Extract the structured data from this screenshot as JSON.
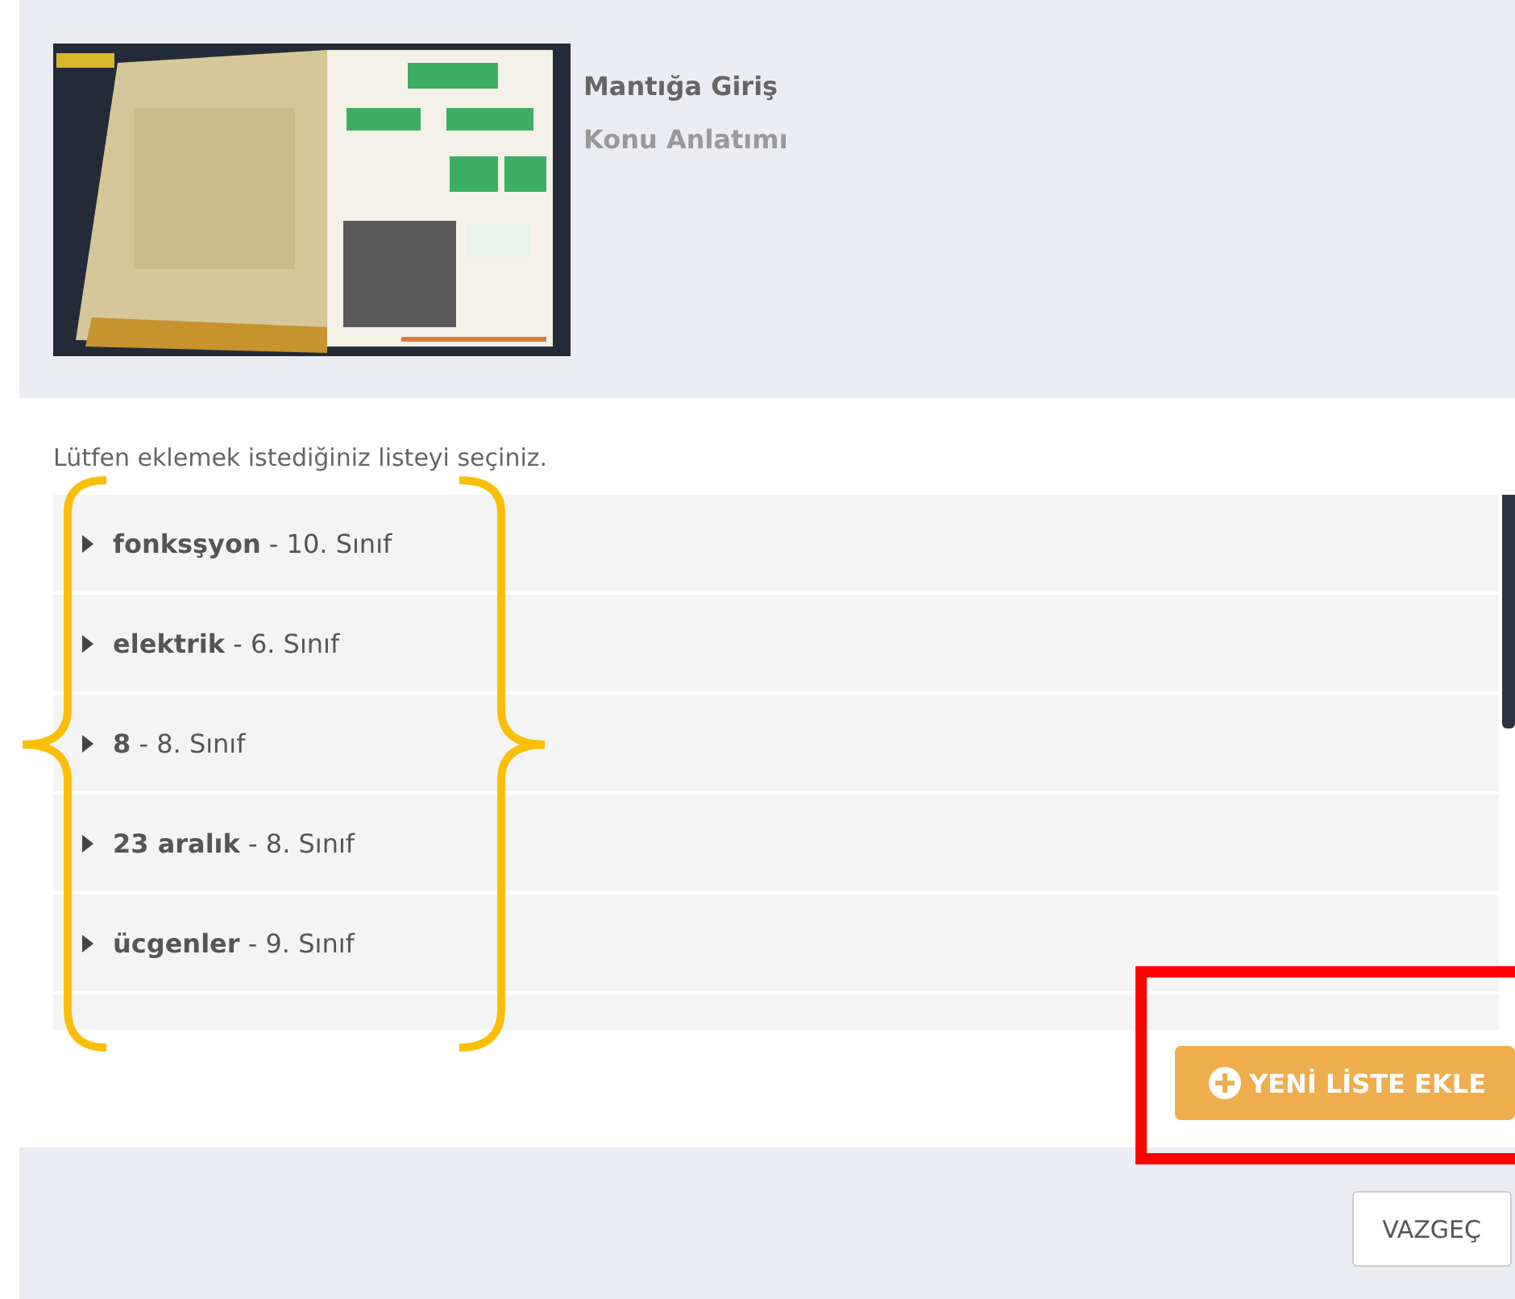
{
  "lesson": {
    "title": "Mantığa Giriş",
    "subtitle": "Konu Anlatımı"
  },
  "instruction": "Lütfen eklemek istediğiniz listeyi seçiniz.",
  "lists": [
    {
      "label": "**fonksşyon** - 10. Sınıf"
    },
    {
      "label": "**elektrik** - 6. Sınıf"
    },
    {
      "label": "**8** - 8. Sınıf"
    },
    {
      "label": "**23 aralık** - 8. Sınıf"
    },
    {
      "label": "**ücgenler** - 9. Sınıf"
    }
  ],
  "add_button": "YENİ LİSTE EKLE",
  "cancel_button": "VAZGEÇ"
}
